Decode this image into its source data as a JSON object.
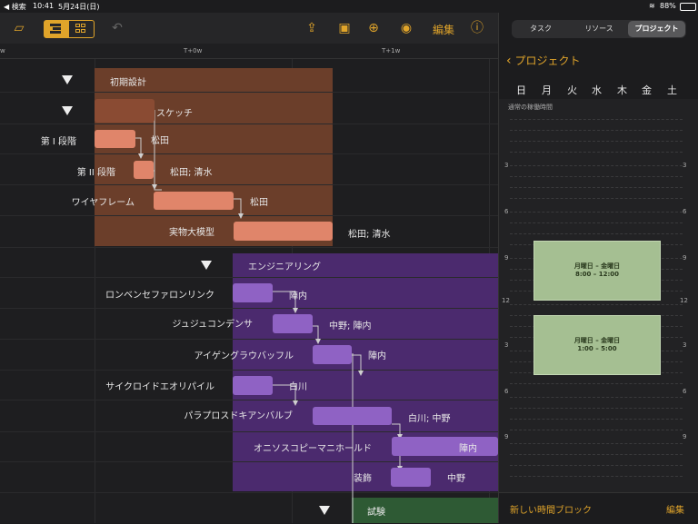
{
  "status": {
    "left": "◀ 検索",
    "time": "10:41",
    "date": "5月24日(日)",
    "battery": "88%"
  },
  "toolbar": {
    "edit_label": "編集"
  },
  "timeline": {
    "ticks": [
      "w",
      "T+0w",
      "T+1w"
    ]
  },
  "gantt": {
    "groups": [
      {
        "name": "初期設計",
        "color": "#6b3e2a",
        "bar_color": "#e0856a"
      },
      {
        "name": "エンジニアリング",
        "color": "#4b2a6e",
        "bar_color": "#8f62c4"
      },
      {
        "name": "試験",
        "color": "#2e5a34"
      }
    ],
    "tasks": [
      {
        "name": "スケッチ",
        "resource": ""
      },
      {
        "name": "第 I 段階",
        "resource": "松田"
      },
      {
        "name": "第 II 段階",
        "resource": "松田; 清水"
      },
      {
        "name": "ワイヤフレーム",
        "resource": "松田"
      },
      {
        "name": "実物大模型",
        "resource": "松田; 清水"
      },
      {
        "name": "ロンベンセファロンリンク",
        "resource": "陣内"
      },
      {
        "name": "ジュジュコンデンサ",
        "resource": "中野; 陣内"
      },
      {
        "name": "アイゲングラウバッフル",
        "resource": "陣内"
      },
      {
        "name": "サイクロイドエオリパイル",
        "resource": "白川"
      },
      {
        "name": "パラプロスドキアンバルブ",
        "resource": "白川; 中野"
      },
      {
        "name": "オニソスコピーマニホールド",
        "resource": "陣内"
      },
      {
        "name": "装飾",
        "resource": "中野"
      }
    ]
  },
  "panel": {
    "tabs": [
      "タスク",
      "リソース",
      "プロジェクト"
    ],
    "selected_tab": "プロジェクト",
    "back_label": "プロジェクト",
    "days": [
      "日",
      "月",
      "火",
      "水",
      "木",
      "金",
      "土"
    ],
    "calendar_title": "通常の稼働時間",
    "hours": [
      "3",
      "6",
      "9",
      "12",
      "3",
      "6",
      "9"
    ],
    "blocks": [
      {
        "title": "月曜日 – 金曜日",
        "time": "8:00 – 12:00"
      },
      {
        "title": "月曜日 – 金曜日",
        "time": "1:00 – 5:00"
      }
    ],
    "new_block_label": "新しい時間ブロック",
    "edit_label": "編集"
  },
  "colors": {
    "accent": "#e0a42a"
  }
}
